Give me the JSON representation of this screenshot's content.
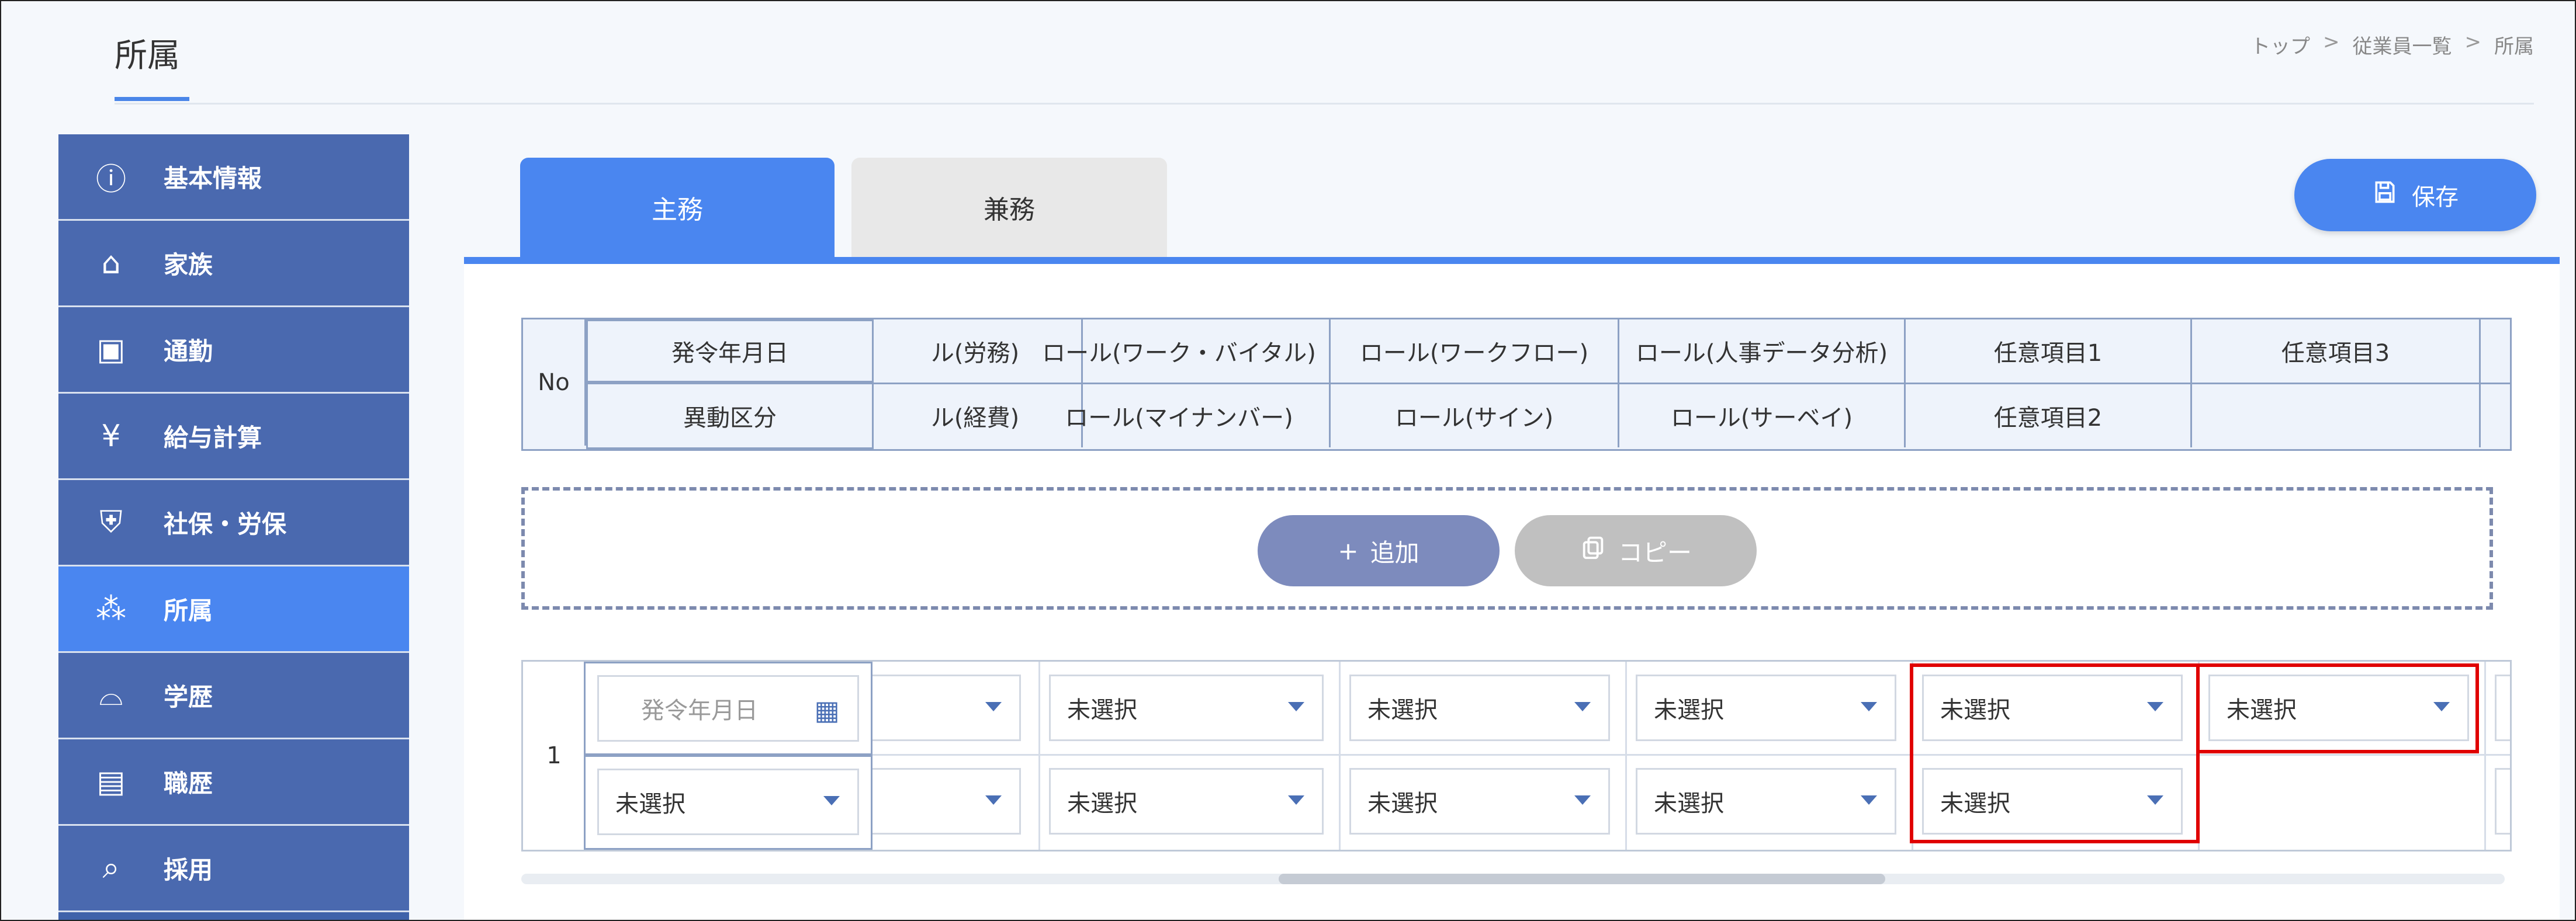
{
  "page": {
    "title": "所属"
  },
  "breadcrumb": {
    "items": [
      "トップ",
      "従業員一覧",
      "所属"
    ],
    "separator": ">"
  },
  "sidebar": {
    "items": [
      {
        "label": "基本情報",
        "icon": "info-icon"
      },
      {
        "label": "家族",
        "icon": "house-icon"
      },
      {
        "label": "通勤",
        "icon": "train-icon"
      },
      {
        "label": "給与計算",
        "icon": "yen-icon"
      },
      {
        "label": "社保・労保",
        "icon": "insurance-icon"
      },
      {
        "label": "所属",
        "icon": "org-chart-icon",
        "active": true
      },
      {
        "label": "学歴",
        "icon": "graduation-cap-icon"
      },
      {
        "label": "職歴",
        "icon": "briefcase-icon"
      },
      {
        "label": "採用",
        "icon": "magnifier-person-icon"
      }
    ]
  },
  "tabs": {
    "main": "主務",
    "sub": "兼務"
  },
  "toolbar": {
    "save_label": "保存"
  },
  "table": {
    "no_header": "No",
    "header_top": [
      "発令年月日",
      "ル(労務)",
      "ロール(ワーク・バイタル)",
      "ロール(ワークフロー)",
      "ロール(人事データ分析)",
      "任意項目1",
      "任意項目3"
    ],
    "header_bottom": [
      "異動区分",
      "ル(経費)",
      "ロール(マイナンバー)",
      "ロール(サイン)",
      "ロール(サーベイ)",
      "任意項目2",
      ""
    ]
  },
  "actions": {
    "add_label": "追加",
    "add_prefix": "+",
    "copy_label": "コピー"
  },
  "row": {
    "no": "1",
    "date_placeholder": "発令年月日",
    "unselected": "未選択"
  },
  "colors": {
    "accent": "#4a86f0",
    "sidebar": "#4a69af",
    "highlight": "#e00000"
  }
}
